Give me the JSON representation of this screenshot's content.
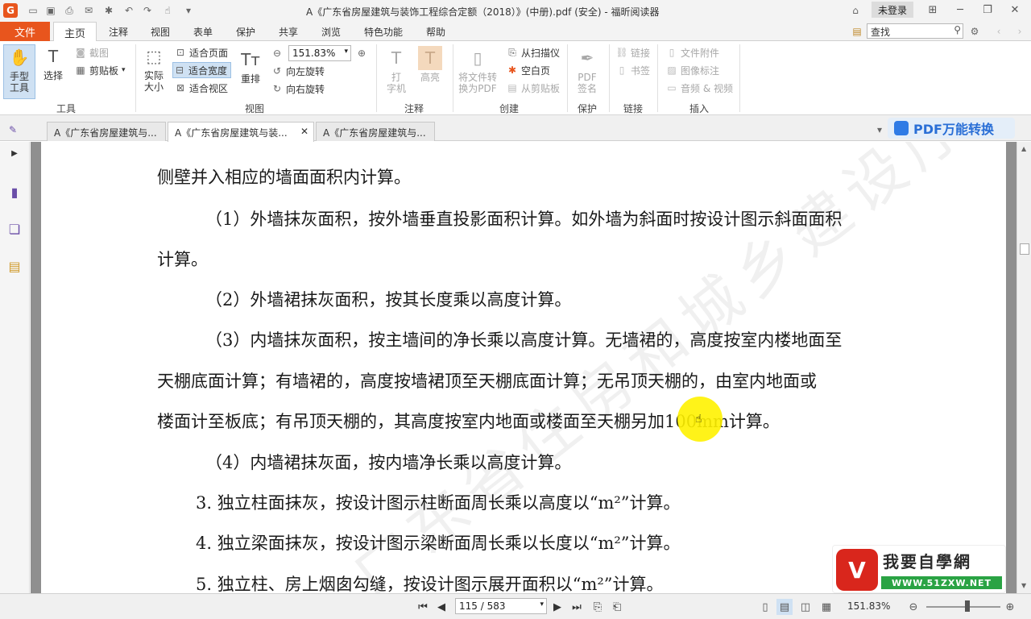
{
  "titlebar": {
    "title": "A《广东省房屋建筑与装饰工程综合定额（2018）》(中册).pdf (安全) - 福昕阅读器",
    "login": "未登录"
  },
  "menu": {
    "file": "文件",
    "tabs": [
      "主页",
      "注释",
      "视图",
      "表单",
      "保护",
      "共享",
      "浏览",
      "特色功能",
      "帮助"
    ],
    "search_placeholder": "查找"
  },
  "ribbon": {
    "tools": {
      "hand": "手型\n工具",
      "select": "选择",
      "screenshot": "截图",
      "clipboard": "剪贴板",
      "group": "工具"
    },
    "view": {
      "actual_size": "实际\n大小",
      "fit_page": "适合页面",
      "fit_width": "适合宽度",
      "fit_visible": "适合视区",
      "reflow": "重排",
      "zoom_value": "151.83%",
      "rotate_left": "向左旋转",
      "rotate_right": "向右旋转",
      "group": "视图"
    },
    "annotate": {
      "typewriter": "打\n字机",
      "highlight": "高亮",
      "group": "注释"
    },
    "create": {
      "convert": "将文件转\n换为PDF",
      "from_scanner": "从扫描仪",
      "blank_page": "空白页",
      "from_clipboard": "从剪贴板",
      "group": "创建"
    },
    "protect": {
      "sign": "PDF\n签名",
      "group": "保护"
    },
    "link": {
      "link": "链接",
      "bookmark": "书签",
      "group": "链接"
    },
    "insert": {
      "attachment": "文件附件",
      "image_annot": "图像标注",
      "av": "音频 & 视频",
      "group": "插入"
    }
  },
  "doctabs": {
    "tabs": [
      "A《广东省房屋建筑与...",
      "A《广东省房屋建筑与装...",
      "A《广东省房屋建筑与..."
    ],
    "convert_banner": "PDF万能转换"
  },
  "document": {
    "lines": [
      "侧壁并入相应的墙面面积内计算。",
      "（1）外墙抹灰面积，按外墙垂直投影面积计算。如外墙为斜面时按设计图示斜面面积",
      "计算。",
      "（2）外墙裙抹灰面积，按其长度乘以高度计算。",
      "（3）内墙抹灰面积，按主墙间的净长乘以高度计算。无墙裙的，高度按室内楼地面至",
      "天棚底面计算；有墙裙的，高度按墙裙顶至天棚底面计算；无吊顶天棚的，由室内地面或",
      "楼面计至板底；有吊顶天棚的，其高度按室内地面或楼面至天棚另加100mm计算。",
      "（4）内墙裙抹灰面，按内墙净长乘以高度计算。",
      "3.  独立柱面抹灰，按设计图示柱断面周长乘以高度以“m²”计算。",
      "4.  独立梁面抹灰，按设计图示梁断面周长乘以长度以“m²”计算。",
      "5.  独立柱、房上烟囱勾缝，按设计图示展开面积以“m²”计算。"
    ],
    "watermark": "广东省住房和城乡建设厅",
    "brand_name": "我要自學網",
    "brand_url": "WWW.51ZXW.NET"
  },
  "status": {
    "page": "115 / 583",
    "zoom": "151.83%"
  },
  "colors": {
    "accent": "#e8551d",
    "selected": "#cfe1f3",
    "highlight_cursor": "#fff200"
  }
}
